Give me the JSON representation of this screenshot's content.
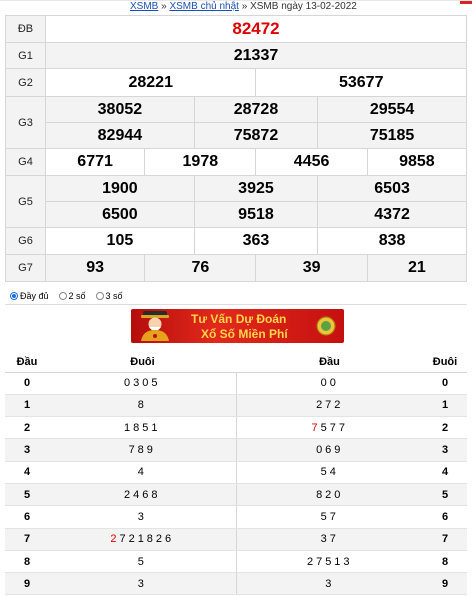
{
  "breadcrumb": {
    "home": "XSMB",
    "sep1": "»",
    "section": "XSMB chủ nhật",
    "sep2": "»",
    "current": "XSMB ngày 13-02-2022"
  },
  "results": {
    "db_label": "ĐB",
    "db": "82472",
    "g1_label": "G1",
    "g1": "21337",
    "g2_label": "G2",
    "g2": [
      "28221",
      "53677"
    ],
    "g3_label": "G3",
    "g3": [
      "38052",
      "28728",
      "29554",
      "82944",
      "75872",
      "75185"
    ],
    "g4_label": "G4",
    "g4": [
      "6771",
      "1978",
      "4456",
      "9858"
    ],
    "g5_label": "G5",
    "g5": [
      "1900",
      "3925",
      "6503",
      "6500",
      "9518",
      "4372"
    ],
    "g6_label": "G6",
    "g6": [
      "105",
      "363",
      "838"
    ],
    "g7_label": "G7",
    "g7": [
      "93",
      "76",
      "39",
      "21"
    ]
  },
  "options": {
    "full": "Đầy đủ",
    "two": "2 số",
    "three": "3 số",
    "selected": "full"
  },
  "banner": {
    "line1": "Tư Vấn Dự Đoán",
    "line2": "Xổ Số Miền Phí"
  },
  "loto": {
    "headers": {
      "dau": "Đầu",
      "duoi": "Đuôi",
      "dau2": "Đầu",
      "duoi2": "Đuôi"
    },
    "rows": [
      {
        "dau": "0",
        "duoi": "0305",
        "dau_list": "00",
        "duoi_key": "0"
      },
      {
        "dau": "1",
        "duoi": "8",
        "dau_list": "272",
        "duoi_key": "1"
      },
      {
        "dau": "2",
        "duoi": "1851",
        "dau_list_red": "7",
        "dau_list": "577",
        "duoi_key": "2"
      },
      {
        "dau": "3",
        "duoi": "789",
        "dau_list": "069",
        "duoi_key": "3"
      },
      {
        "dau": "4",
        "duoi": "4",
        "dau_list": "54",
        "duoi_key": "4"
      },
      {
        "dau": "5",
        "duoi": "2468",
        "dau_list": "820",
        "duoi_key": "5"
      },
      {
        "dau": "6",
        "duoi": "3",
        "dau_list": "57",
        "duoi_key": "6"
      },
      {
        "dau": "7",
        "duoi_red": "2",
        "duoi": "721826",
        "dau_list": "37",
        "duoi_key": "7"
      },
      {
        "dau": "8",
        "duoi": "5",
        "dau_list": "27513",
        "duoi_key": "8"
      },
      {
        "dau": "9",
        "duoi": "3",
        "dau_list": "3",
        "duoi_key": "9"
      }
    ]
  },
  "colors": {
    "accent_red": "#d00000",
    "link_blue": "#1a4fb5",
    "banner_red": "#c51010",
    "banner_text": "#ffd54a"
  }
}
